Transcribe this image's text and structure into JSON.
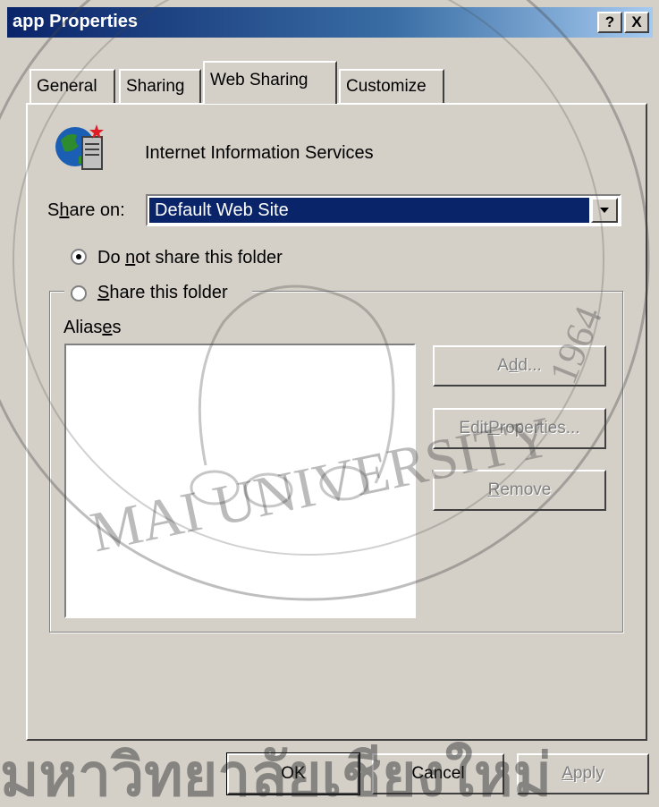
{
  "window": {
    "title": "app Properties",
    "help_button": "?",
    "close_button": "X"
  },
  "tabs": [
    {
      "label": "General",
      "active": false
    },
    {
      "label": "Sharing",
      "active": false
    },
    {
      "label": "Web Sharing",
      "active": true
    },
    {
      "label": "Customize",
      "active": false
    }
  ],
  "service": {
    "icon": "iis-globe-server-icon",
    "label": "Internet Information Services"
  },
  "share_on": {
    "label_pre": "S",
    "label_mnemonic": "h",
    "label_post": "are on:",
    "value": "Default Web Site"
  },
  "radio_not_share": {
    "pre": "Do ",
    "mnemonic": "n",
    "post": "ot share this folder",
    "checked": true
  },
  "radio_share": {
    "mnemonic": "S",
    "post": "hare this folder",
    "checked": false
  },
  "aliases": {
    "pre": "Alias",
    "mnemonic": "e",
    "post": "s",
    "items": []
  },
  "side_buttons": {
    "add": {
      "pre": "A",
      "mnemonic": "d",
      "post": "d...",
      "enabled": false
    },
    "edit": {
      "pre": "Edit ",
      "mnemonic": "P",
      "post": "roperties...",
      "enabled": false
    },
    "remove": {
      "pre": "",
      "mnemonic": "R",
      "post": "emove",
      "enabled": false
    }
  },
  "footer": {
    "ok": "OK",
    "cancel": "Cancel",
    "apply_mnemonic": "A",
    "apply_post": "pply"
  },
  "watermark": {
    "arc_text": "MAI UNIVERSITY",
    "year": "1964",
    "thai_text": "มหาวิทยาลัยเชียงใหม่"
  },
  "colors": {
    "face": "#d4d0c8",
    "title_start": "#0a246a",
    "title_end": "#a6caf0",
    "selection": "#0a246a"
  }
}
